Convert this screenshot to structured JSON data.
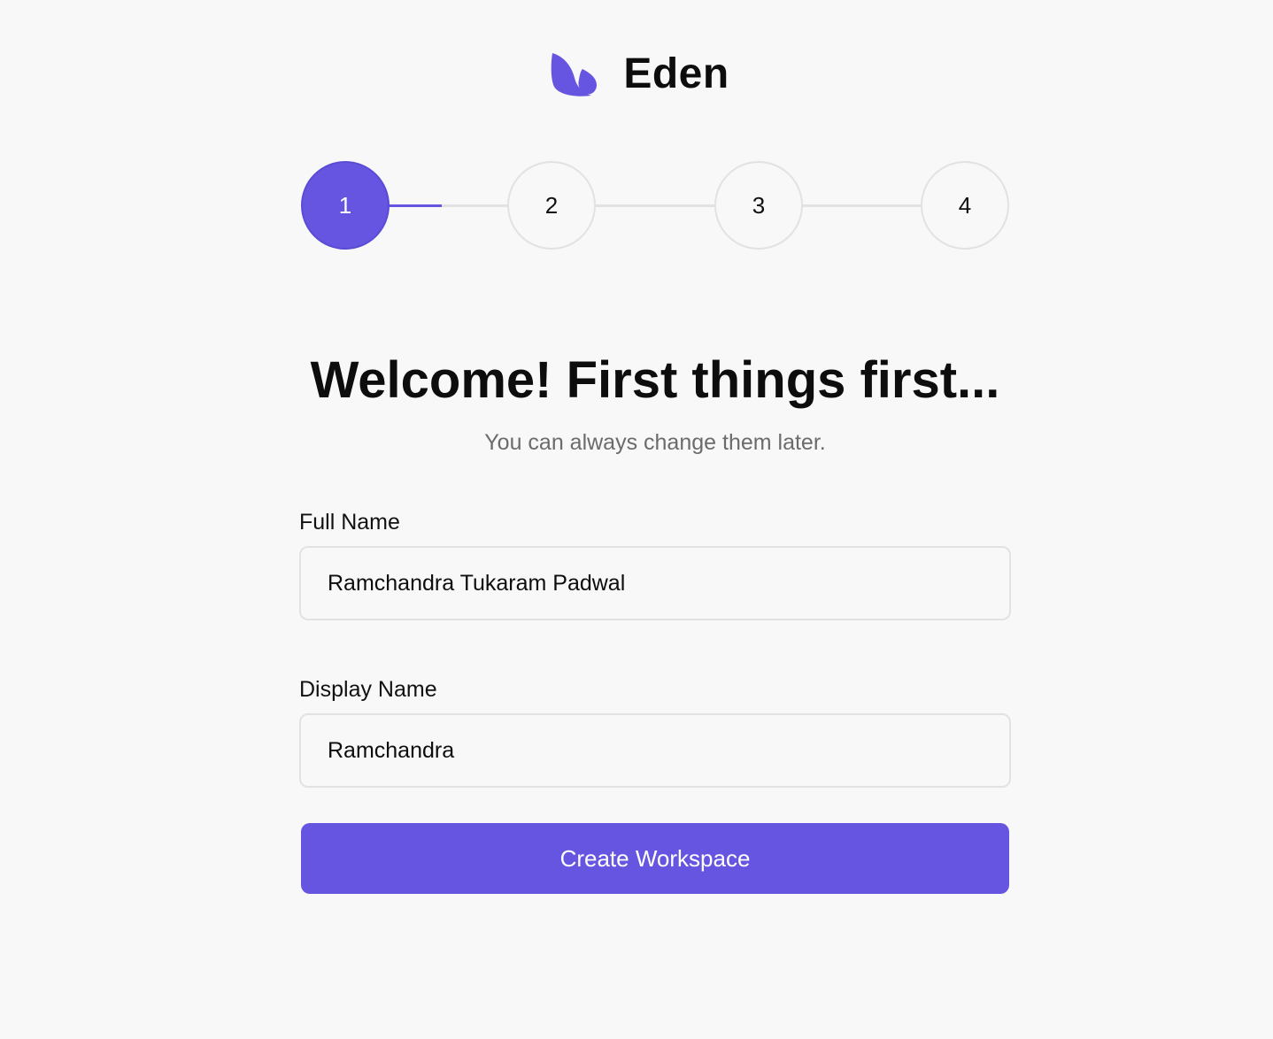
{
  "brand": {
    "name": "Eden",
    "logo_icon": "leaf-logo-icon"
  },
  "colors": {
    "accent": "#6655e0",
    "accent_border": "#5a4bd6",
    "border": "#e2e1e3",
    "background": "#f9f8f9",
    "muted_text": "#6b6b6b"
  },
  "stepper": {
    "current_step": 1,
    "progress_to_next": 0.45,
    "steps": [
      {
        "label": "1"
      },
      {
        "label": "2"
      },
      {
        "label": "3"
      },
      {
        "label": "4"
      }
    ]
  },
  "header": {
    "title": "Welcome! First things first...",
    "subtitle": "You can always change them later."
  },
  "form": {
    "full_name": {
      "label": "Full Name",
      "value": "Ramchandra Tukaram Padwal"
    },
    "display_name": {
      "label": "Display Name",
      "value": "Ramchandra"
    },
    "submit_label": "Create Workspace"
  }
}
